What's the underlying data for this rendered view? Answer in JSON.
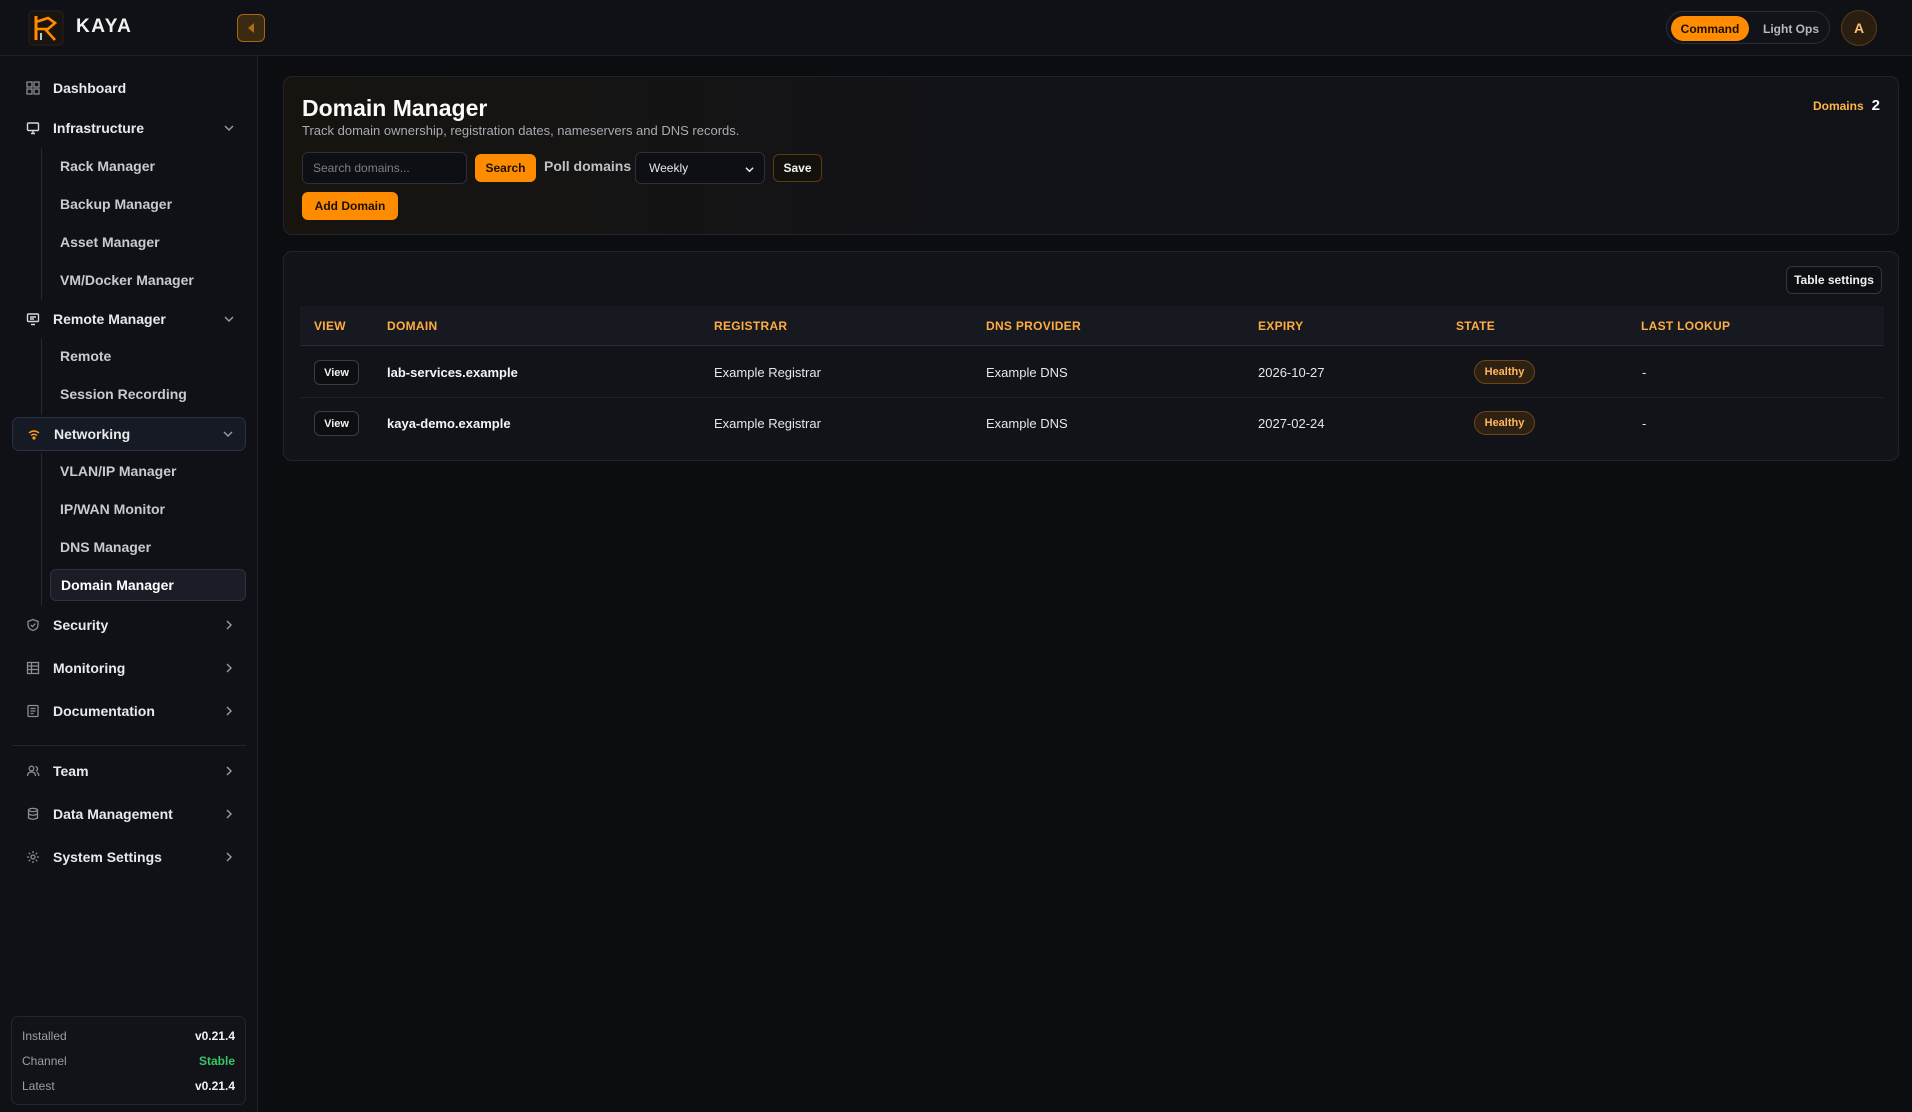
{
  "header": {
    "brand": "KAYA",
    "modes": {
      "active": "Command",
      "inactive": "Light Ops"
    },
    "avatar_initial": "A"
  },
  "sidebar": {
    "dashboard": "Dashboard",
    "infrastructure": {
      "label": "Infrastructure",
      "items": [
        "Rack Manager",
        "Backup Manager",
        "Asset Manager",
        "VM/Docker Manager"
      ]
    },
    "remote": {
      "label": "Remote Manager",
      "items": [
        "Remote",
        "Session Recording"
      ]
    },
    "networking": {
      "label": "Networking",
      "items": [
        "VLAN/IP Manager",
        "IP/WAN Monitor",
        "DNS Manager",
        "Domain Manager"
      ]
    },
    "security": "Security",
    "monitoring": "Monitoring",
    "documentation": "Documentation",
    "team": "Team",
    "data_management": "Data Management",
    "system_settings": "System Settings"
  },
  "version": {
    "installed_label": "Installed",
    "installed_value": "v0.21.4",
    "channel_label": "Channel",
    "channel_value": "Stable",
    "latest_label": "Latest",
    "latest_value": "v0.21.4"
  },
  "page": {
    "title": "Domain Manager",
    "subtitle": "Track domain ownership, registration dates, nameservers and DNS records.",
    "counter_label": "Domains",
    "counter_value": "2",
    "search_placeholder": "Search domains...",
    "search_button": "Search",
    "poll_label": "Poll domains",
    "poll_value": "Weekly",
    "save_button": "Save",
    "add_button": "Add Domain"
  },
  "table": {
    "settings_button": "Table settings",
    "columns": [
      "VIEW",
      "DOMAIN",
      "REGISTRAR",
      "DNS PROVIDER",
      "EXPIRY",
      "STATE",
      "LAST LOOKUP"
    ],
    "rows": [
      {
        "view": "View",
        "domain": "lab-services.example",
        "registrar": "Example Registrar",
        "dns": "Example DNS",
        "expiry": "2026-10-27",
        "state": "Healthy",
        "last_lookup": "-"
      },
      {
        "view": "View",
        "domain": "kaya-demo.example",
        "registrar": "Example Registrar",
        "dns": "Example DNS",
        "expiry": "2027-02-24",
        "state": "Healthy",
        "last_lookup": "-"
      }
    ]
  },
  "colors": {
    "accent": "#ff8c00",
    "header_text": "#ffad42",
    "badge_text": "#ffb85c",
    "stable": "#38c46a"
  }
}
